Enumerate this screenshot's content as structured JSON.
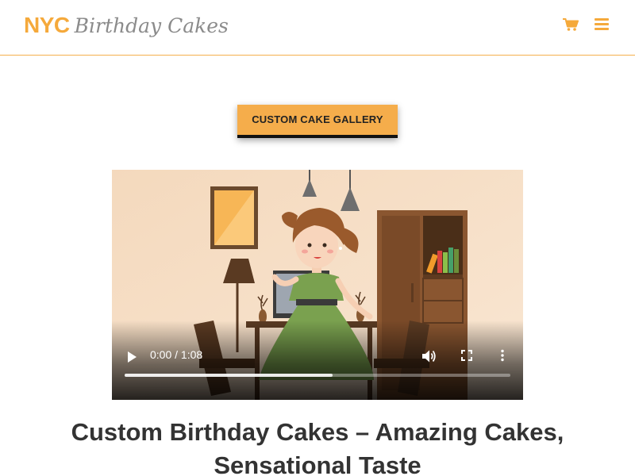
{
  "header": {
    "logo_part1": "NYC",
    "logo_part2": "Birthday Cakes",
    "cart_icon": "shopping-cart-icon",
    "menu_icon": "hamburger-menu-icon"
  },
  "main": {
    "gallery_button_label": "CUSTOM CAKE GALLERY",
    "video": {
      "current_time": "0:00",
      "duration": "1:08",
      "time_display": "0:00 / 1:08",
      "buffered_fraction": 0.54,
      "play_icon": "play-icon",
      "volume_icon": "volume-icon",
      "fullscreen_icon": "fullscreen-icon",
      "more_icon": "more-options-icon"
    },
    "heading": "Custom Birthday Cakes – Amazing Cakes, Sensational Taste"
  },
  "colors": {
    "brand_orange": "#f5a93b",
    "button_bg": "#f5ad4b",
    "logo_gray": "#8b8b8b",
    "heading_text": "#333333"
  }
}
